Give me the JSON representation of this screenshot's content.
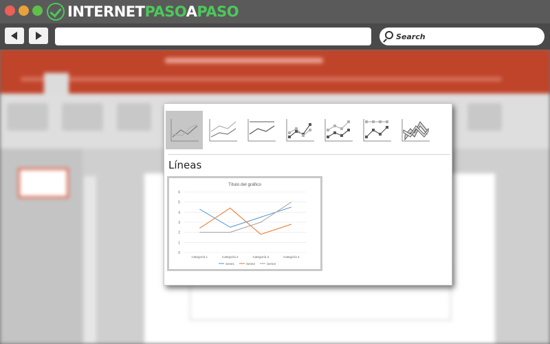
{
  "browser": {
    "logo": {
      "part1": "INTERNET",
      "part2": "PASO",
      "part3": "A",
      "part4": "PASO"
    },
    "url": {
      "value": ""
    },
    "search": {
      "placeholder": "Search"
    },
    "colors": {
      "logo_white": "#ffffff",
      "logo_green": "#4cc85a"
    }
  },
  "gallery": {
    "variants": [
      {
        "id": "line",
        "icon": "line-chart-icon",
        "selected": true
      },
      {
        "id": "stacked-line",
        "icon": "stacked-line-chart-icon",
        "selected": false
      },
      {
        "id": "100-stacked-line",
        "icon": "100-stacked-line-chart-icon",
        "selected": false
      },
      {
        "id": "line-markers",
        "icon": "line-with-markers-chart-icon",
        "selected": false
      },
      {
        "id": "stacked-line-markers",
        "icon": "stacked-line-with-markers-chart-icon",
        "selected": false
      },
      {
        "id": "100-stacked-line-markers",
        "icon": "100-stacked-line-with-markers-chart-icon",
        "selected": false
      },
      {
        "id": "3d-line",
        "icon": "3d-line-chart-icon",
        "selected": false
      }
    ],
    "section_title": "Líneas"
  },
  "chart_data": {
    "type": "line",
    "title": "Título del gráfico",
    "categories": [
      "Categoría 1",
      "Categoría 2",
      "Categoría 3",
      "Categoría 4"
    ],
    "series": [
      {
        "name": "Serie1",
        "values": [
          4.3,
          2.5,
          3.5,
          4.5
        ],
        "color": "#5b9bd5"
      },
      {
        "name": "Serie2",
        "values": [
          2.4,
          4.4,
          1.8,
          2.8
        ],
        "color": "#ed7d31"
      },
      {
        "name": "Serie3",
        "values": [
          2,
          2,
          3,
          5
        ],
        "color": "#a5a5a5"
      }
    ],
    "yticks": [
      0,
      1,
      2,
      3,
      4,
      5,
      6
    ],
    "ylim": [
      0,
      6
    ],
    "grid": true,
    "legend": "bottom"
  }
}
